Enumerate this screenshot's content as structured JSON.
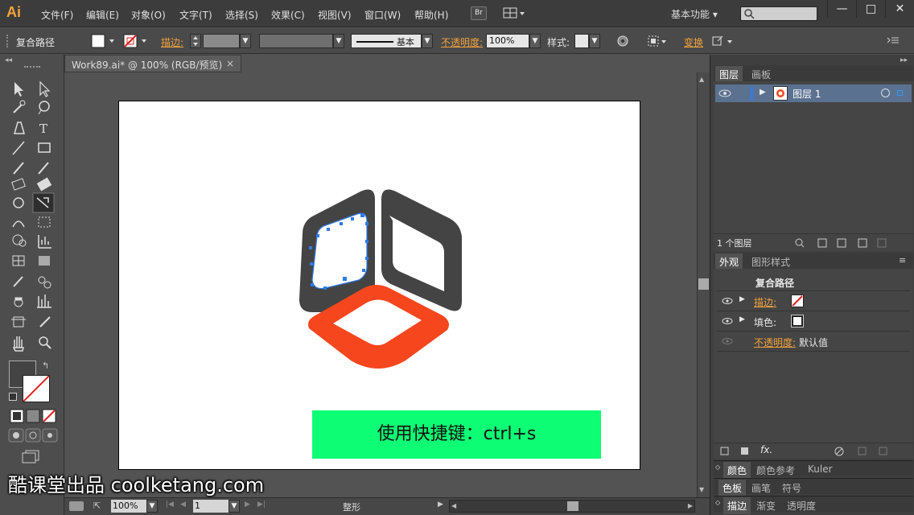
{
  "app": {
    "logo": "Ai"
  },
  "menu": [
    "文件(F)",
    "编辑(E)",
    "对象(O)",
    "文字(T)",
    "选择(S)",
    "效果(C)",
    "视图(V)",
    "窗口(W)",
    "帮助(H)"
  ],
  "menubar_extra": {
    "bridge": "Br",
    "workspace": "基本功能",
    "workspace_arrow": "▾"
  },
  "window_controls": {
    "min": "—",
    "max": "□",
    "close": "✕"
  },
  "control_bar": {
    "selection_label": "复合路径",
    "stroke_label": "描边:",
    "stroke_style": "基本",
    "opacity_label": "不透明度:",
    "opacity_value": "100%",
    "style_label": "样式:",
    "transform_label": "变换"
  },
  "document": {
    "tab_title": "Work89.ai* @ 100% (RGB/预览)",
    "tab_close": "×"
  },
  "banner": {
    "text": "使用快捷键：ctrl+s"
  },
  "watermark": {
    "text": "酷课堂出品 coolketang.com"
  },
  "status_bar": {
    "zoom": "100%",
    "page": "1",
    "tool_name": "整形"
  },
  "layers_panel": {
    "tabs": [
      "图层",
      "画板"
    ],
    "layer_name": "图层 1",
    "footer_count": "1 个图层"
  },
  "appearance_panel": {
    "tabs": [
      "外观",
      "图形样式"
    ],
    "header": "复合路径",
    "rows": [
      {
        "label": "描边:"
      },
      {
        "label": "填色:"
      },
      {
        "label": "不透明度:",
        "value": "默认值"
      }
    ],
    "fx": "fx."
  },
  "collapsed_panels": [
    [
      "颜色",
      "颜色参考",
      "Kuler"
    ],
    [
      "色板",
      "画笔",
      "符号"
    ],
    [
      "描边",
      "渐变",
      "透明度"
    ]
  ],
  "colors": {
    "logo_dark": "#444444",
    "logo_orange": "#f5461e",
    "selection_blue": "#2f7be8",
    "banner_green": "#0dfd74"
  }
}
